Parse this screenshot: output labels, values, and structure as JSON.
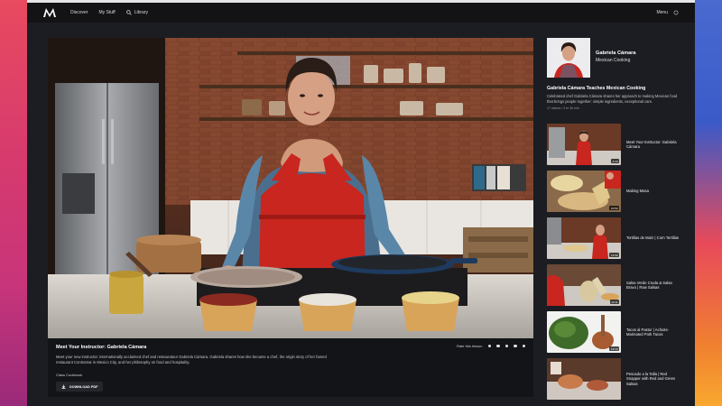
{
  "nav": {
    "items": [
      {
        "label": "Discover"
      },
      {
        "label": "My Stuff"
      },
      {
        "label": "Library"
      }
    ],
    "menu_label": "Menu"
  },
  "video": {
    "lesson_title": "Meet Your Instructor: Gabriela Cámara",
    "description": "Meet your new instructor: internationally acclaimed chef and restaurateur Gabriela Cámara. Gabriela shares how she became a chef, the origin story of her famed restaurant Contramar in Mexico City, and her philosophy on food and hospitality.",
    "cookbook_label": "Class Cookbook",
    "download_label": "DOWNLOAD PDF",
    "rate_label": "Rate this lesson"
  },
  "instructor": {
    "name": "Gabriela Cámara",
    "subject": "Mexican Cooking"
  },
  "course": {
    "title": "Gabriela Cámara Teaches Mexican Cooking",
    "description": "Celebrated chef Gabriela Cámara shares her approach to making Mexican food that brings people together: simple ingredients, exceptional care.",
    "meta": "17 videos • 3 hr 36 min"
  },
  "episodes": [
    {
      "title": "Meet Your Instructor: Gabriela Cámara",
      "time": "4:13"
    },
    {
      "title": "Making Masa",
      "time": "10:50"
    },
    {
      "title": "Tortillas de Maíz | Corn Tortillas",
      "time": "14:59"
    },
    {
      "title": "Salsa Verde Cruda & Salsa Bravo | Raw Salsas",
      "time": "14:11"
    },
    {
      "title": "Tacos al Pastor | Achiote-Marinated Pork Tacos",
      "time": "13:19"
    },
    {
      "title": "Pescado a la Talla | Red Snapper with Red and Green Salsas",
      "time": ""
    }
  ],
  "colors": {
    "accent": "#c8261f",
    "background": "#1b1d22"
  }
}
